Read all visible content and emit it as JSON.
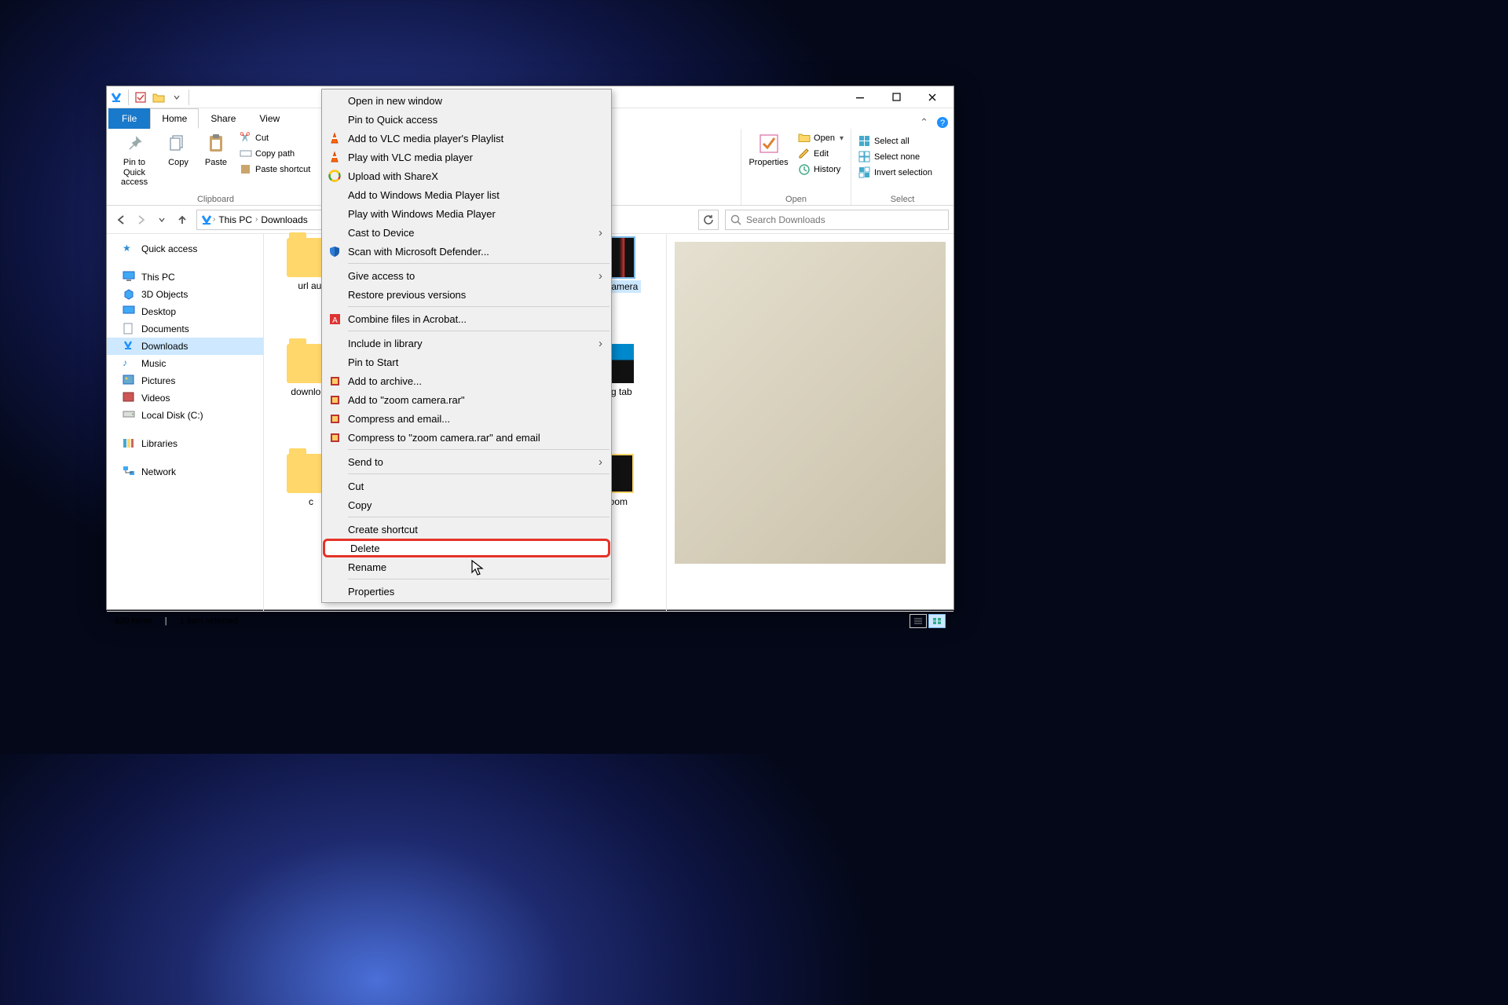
{
  "tabs": {
    "file": "File",
    "home": "Home",
    "share": "Share",
    "view": "View"
  },
  "ribbon": {
    "pin": "Pin to Quick access",
    "copy": "Copy",
    "paste": "Paste",
    "cut": "Cut",
    "copypath": "Copy path",
    "pasteshortcut": "Paste shortcut",
    "clipboard": "Clipboard",
    "properties": "Properties",
    "open": "Open",
    "edit": "Edit",
    "history": "History",
    "open_grp": "Open",
    "selectall": "Select all",
    "selectnone": "Select none",
    "invert": "Invert selection",
    "select_grp": "Select"
  },
  "crumbs": {
    "pc": "This PC",
    "loc": "Downloads"
  },
  "search": {
    "placeholder": "Search Downloads"
  },
  "side": {
    "quick": "Quick access",
    "pc": "This PC",
    "items": [
      "3D Objects",
      "Desktop",
      "Documents",
      "Downloads",
      "Music",
      "Pictures",
      "Videos",
      "Local Disk (C:)"
    ],
    "libraries": "Libraries",
    "network": "Network"
  },
  "items": {
    "a": "url aut",
    "b": "download",
    "c": "c",
    "d": "zoom camera",
    "e": "closing tab",
    "f": "on zoom"
  },
  "ctx": {
    "open_new": "Open in new window",
    "pin_quick": "Pin to Quick access",
    "vlc_add": "Add to VLC media player's Playlist",
    "vlc_play": "Play with VLC media player",
    "sharex": "Upload with ShareX",
    "wmp_add": "Add to Windows Media Player list",
    "wmp_play": "Play with Windows Media Player",
    "cast": "Cast to Device",
    "defender": "Scan with Microsoft Defender...",
    "give_access": "Give access to",
    "restore": "Restore previous versions",
    "acrobat": "Combine files in Acrobat...",
    "include": "Include in library",
    "pin_start": "Pin to Start",
    "archive": "Add to archive...",
    "rar": "Add to \"zoom camera.rar\"",
    "compress_email": "Compress and email...",
    "compress_rar_email": "Compress to \"zoom camera.rar\" and email",
    "send_to": "Send to",
    "cut": "Cut",
    "copy": "Copy",
    "shortcut": "Create shortcut",
    "delete": "Delete",
    "rename": "Rename",
    "props": "Properties"
  },
  "status": {
    "count": "820 items",
    "sel": "1 item selected"
  }
}
